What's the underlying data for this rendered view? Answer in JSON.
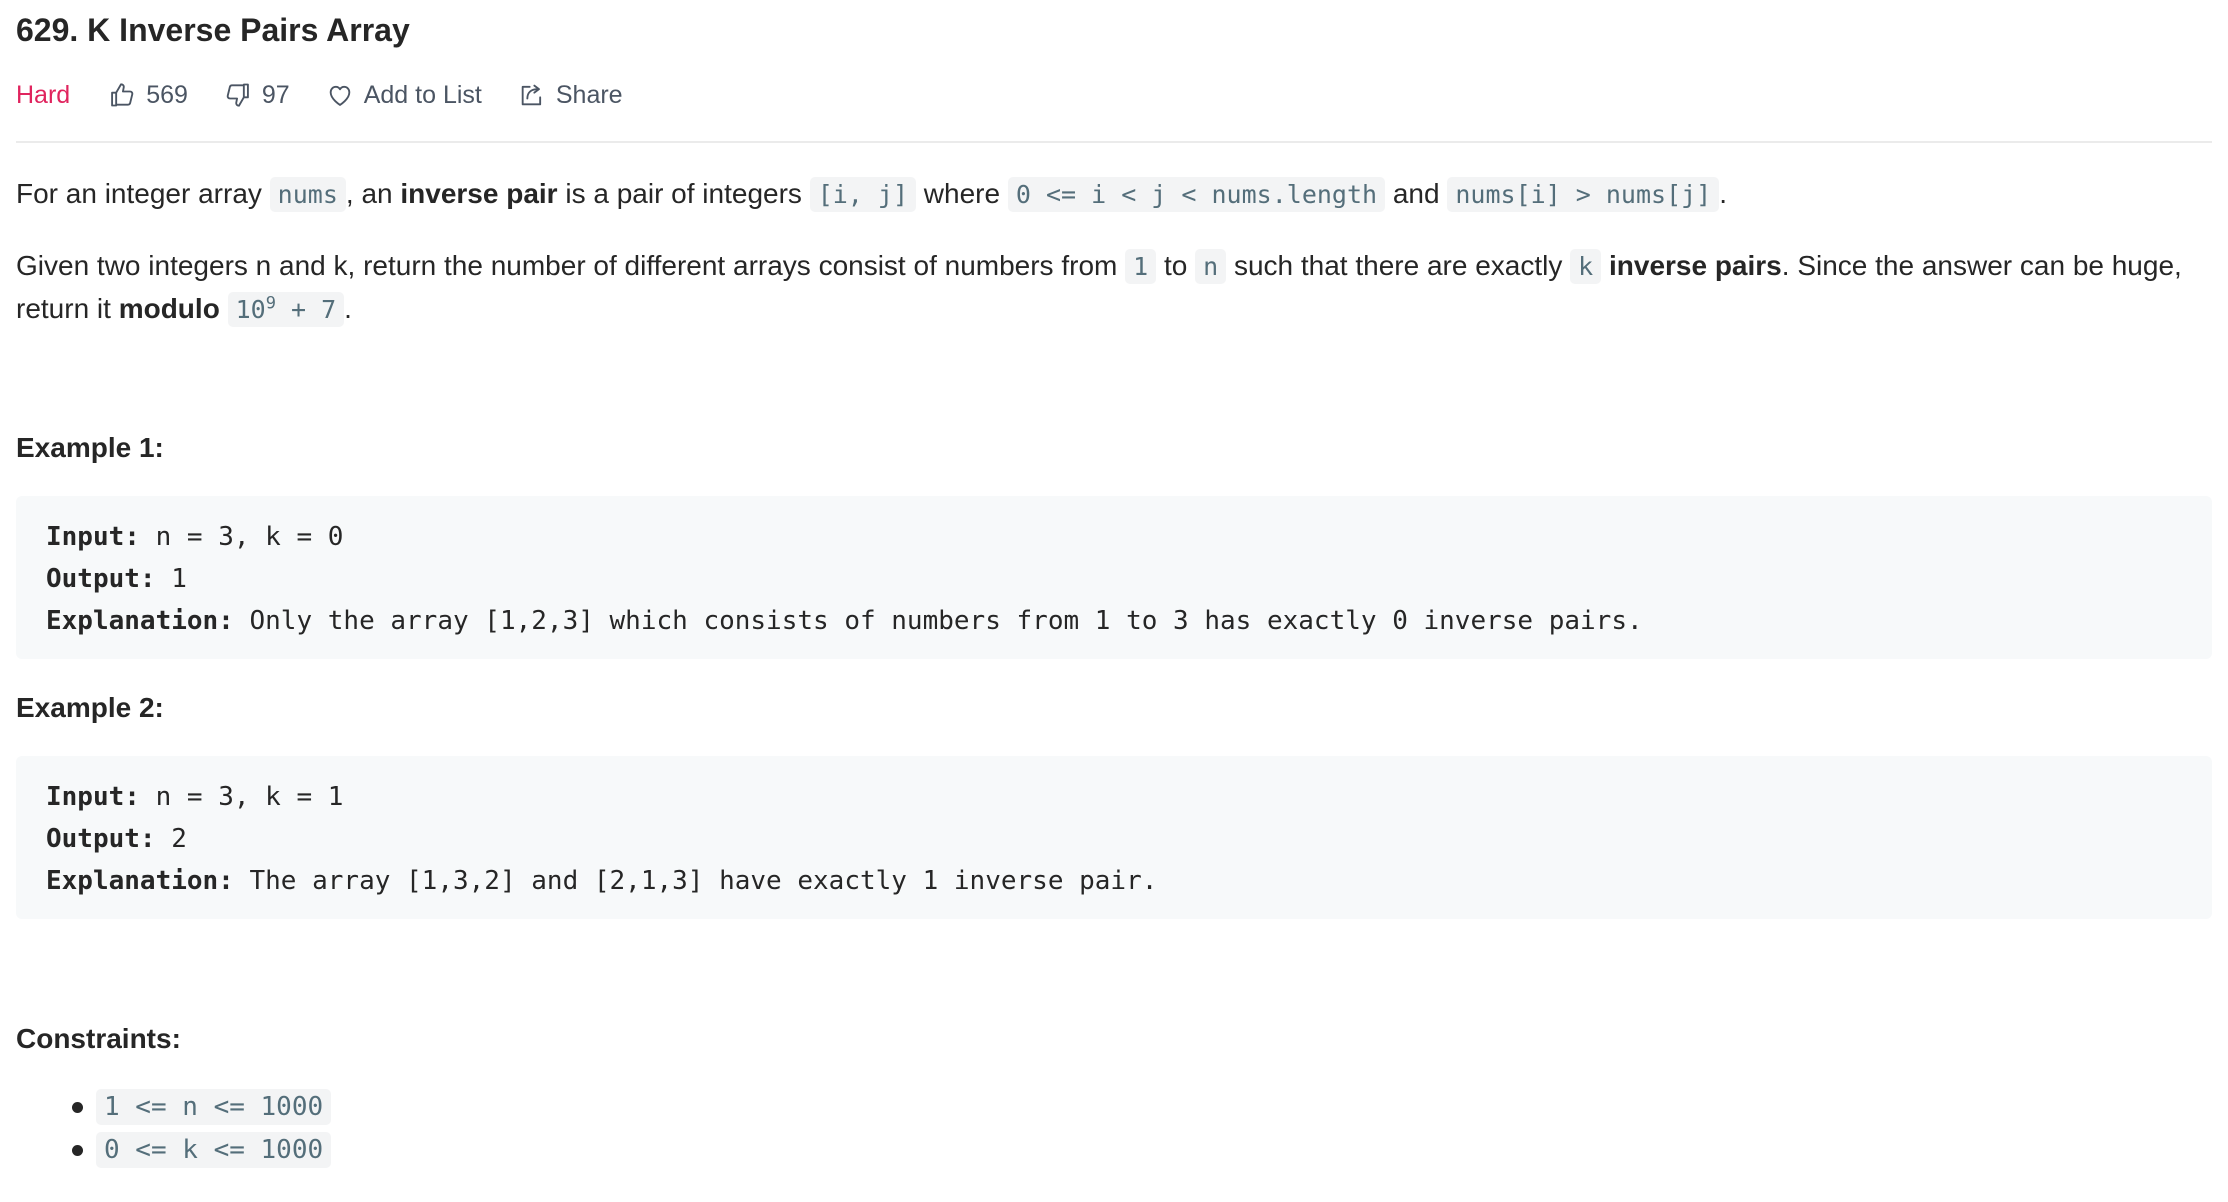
{
  "problem": {
    "title": "629. K Inverse Pairs Array",
    "difficulty": "Hard",
    "likes": "569",
    "dislikes": "97",
    "add_to_list_label": "Add to List",
    "share_label": "Share",
    "difficulty_color": "#e0245e"
  },
  "description": {
    "p1": {
      "t1": "For an integer array ",
      "c1": "nums",
      "t2": ", an ",
      "b1": "inverse pair",
      "t3": " is a pair of integers ",
      "c2": "[i, j]",
      "t4": " where ",
      "c3": "0 <= i < j < nums.length",
      "t5": " and ",
      "c4": "nums[i] > nums[j]",
      "t6": "."
    },
    "p2": {
      "t1": "Given two integers n and k, return the number of different arrays consist of numbers from ",
      "c1": "1",
      "t2": " to ",
      "c2": "n",
      "t3": " such that there are exactly ",
      "c3": "k",
      "t4": " ",
      "b1": "inverse pairs",
      "t5": ". Since the answer can be huge, return it ",
      "b2": "modulo",
      "t6": " ",
      "c4_base": "10",
      "c4_exp": "9",
      "c4_rest": " + 7",
      "t7": "."
    }
  },
  "examples": [
    {
      "heading": "Example 1:",
      "input_label": "Input:",
      "input": " n = 3, k = 0",
      "output_label": "Output:",
      "output": " 1",
      "explanation_label": "Explanation:",
      "explanation": " Only the array [1,2,3] which consists of numbers from 1 to 3 has exactly 0 inverse pairs."
    },
    {
      "heading": "Example 2:",
      "input_label": "Input:",
      "input": " n = 3, k = 1",
      "output_label": "Output:",
      "output": " 2",
      "explanation_label": "Explanation:",
      "explanation": " The array [1,3,2] and [2,1,3] have exactly 1 inverse pair."
    }
  ],
  "constraints": {
    "heading": "Constraints:",
    "items": [
      "1 <= n <= 1000",
      "0 <= k <= 1000"
    ]
  }
}
